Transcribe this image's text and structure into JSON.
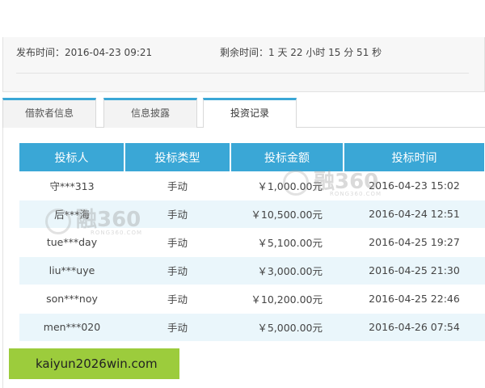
{
  "info": {
    "publish_time": "发布时间：2016-04-23 09:21",
    "remaining_time": "剩余时间：1 天 22 小时 15 分 51 秒"
  },
  "tabs": [
    {
      "label": "借款者信息",
      "active": false
    },
    {
      "label": "信息披露",
      "active": false
    },
    {
      "label": "投资记录",
      "active": true
    }
  ],
  "table": {
    "headers": [
      "投标人",
      "投标类型",
      "投标金额",
      "投标时间"
    ],
    "rows": [
      [
        "守***313",
        "手动",
        "￥1,000.00元",
        "2016-04-23 15:02"
      ],
      [
        "后***海",
        "手动",
        "￥10,500.00元",
        "2016-04-24 12:51"
      ],
      [
        "tue***day",
        "手动",
        "￥5,100.00元",
        "2016-04-25 19:27"
      ],
      [
        "liu***uye",
        "手动",
        "￥3,000.00元",
        "2016-04-25 21:30"
      ],
      [
        "son***noy",
        "手动",
        "￥10,200.00元",
        "2016-04-25 22:46"
      ],
      [
        "men***020",
        "手动",
        "￥5,000.00元",
        "2016-04-26 07:54"
      ]
    ]
  },
  "watermark": {
    "text": "融360",
    "subtext": "RONG360.COM"
  },
  "banner": {
    "text": "kaiyun2026win.com"
  },
  "colors": {
    "accent": "#3aa7d6",
    "row_alt": "#eaf6fb",
    "banner": "#9ccc3c"
  }
}
